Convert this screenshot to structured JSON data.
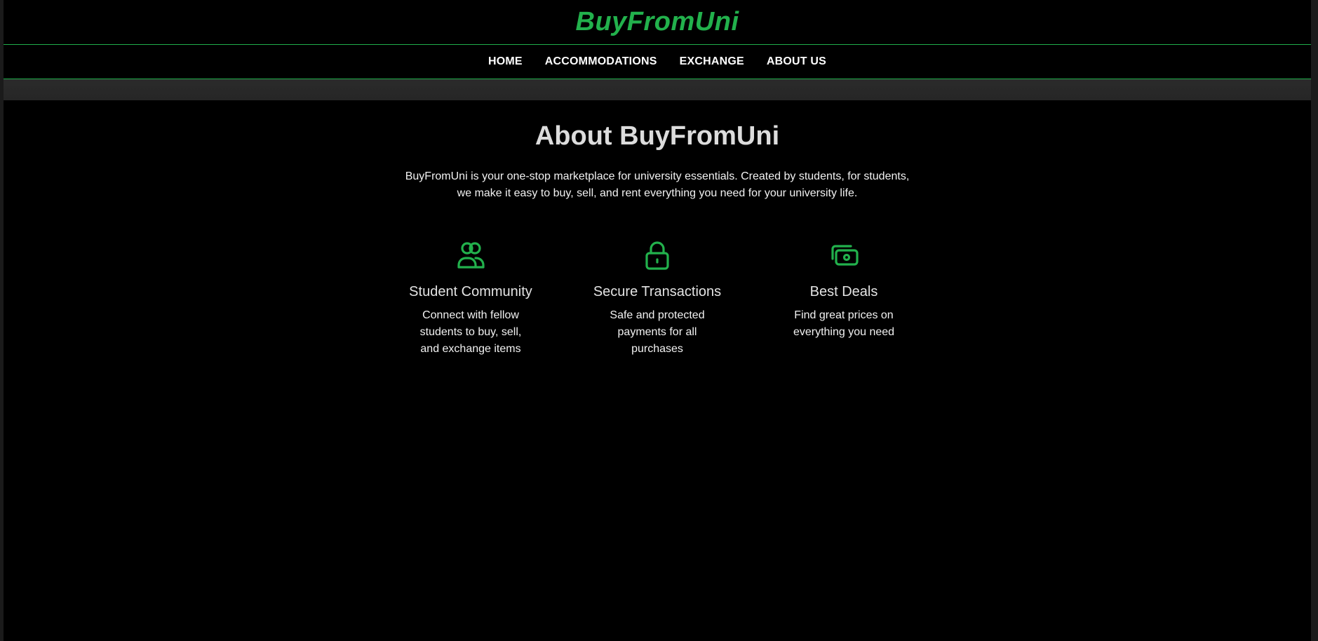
{
  "header": {
    "brand": "BuyFromUni"
  },
  "nav": {
    "items": [
      {
        "label": "HOME"
      },
      {
        "label": "ACCOMMODATIONS"
      },
      {
        "label": "EXCHANGE"
      },
      {
        "label": "ABOUT US"
      }
    ]
  },
  "about": {
    "title": "About BuyFromUni",
    "text": "BuyFromUni is your one-stop marketplace for university essentials. Created by students, for students, we make it easy to buy, sell, and rent everything you need for your university life."
  },
  "features": [
    {
      "icon": "users-icon",
      "title": "Student Community",
      "desc": "Connect with fellow students to buy, sell, and exchange items"
    },
    {
      "icon": "lock-icon",
      "title": "Secure Transactions",
      "desc": "Safe and protected payments for all purchases"
    },
    {
      "icon": "cash-icon",
      "title": "Best Deals",
      "desc": "Find great prices on everything you need"
    }
  ],
  "colors": {
    "accent": "#22b14c",
    "background": "#000000",
    "subbar": "#2a2a2a"
  }
}
